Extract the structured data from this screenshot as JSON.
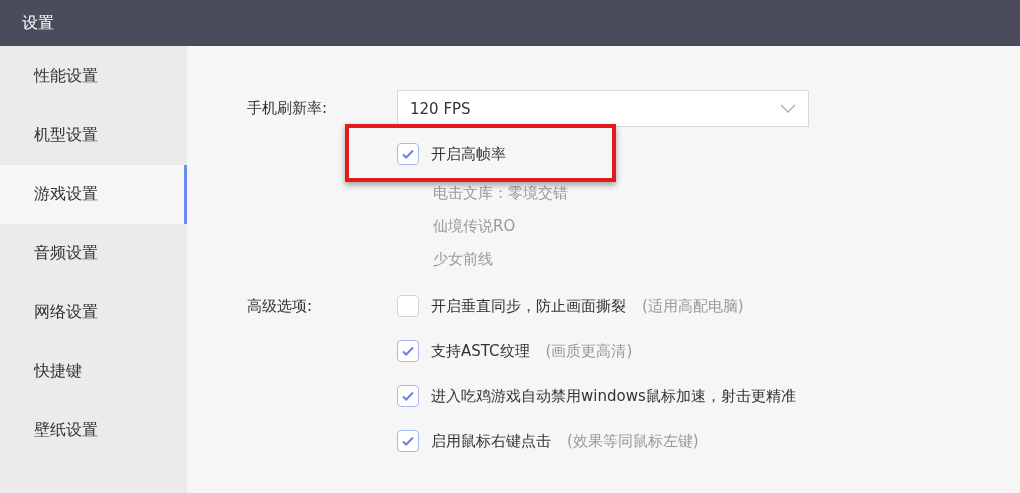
{
  "window": {
    "title": "设置"
  },
  "sidebar": {
    "items": [
      {
        "label": "性能设置",
        "selected": false
      },
      {
        "label": "机型设置",
        "selected": false
      },
      {
        "label": "游戏设置",
        "selected": true
      },
      {
        "label": "音频设置",
        "selected": false
      },
      {
        "label": "网络设置",
        "selected": false
      },
      {
        "label": "快捷键",
        "selected": false
      },
      {
        "label": "壁纸设置",
        "selected": false
      }
    ]
  },
  "refresh_rate": {
    "label": "手机刷新率:",
    "value": "120 FPS"
  },
  "high_frame": {
    "label": "开启高帧率",
    "checked": true,
    "highlighted": true,
    "games": [
      "电击文库：零境交错",
      "仙境传说RO",
      "少女前线"
    ]
  },
  "advanced": {
    "label": "高级选项:",
    "options": [
      {
        "label": "开启垂直同步，防止画面撕裂",
        "note": "(适用高配电脑)",
        "checked": false
      },
      {
        "label": "支持ASTC纹理",
        "note": "(画质更高清)",
        "checked": true
      },
      {
        "label": "进入吃鸡游戏自动禁用windows鼠标加速，射击更精准",
        "checked": true
      },
      {
        "label": "启用鼠标右键点击",
        "note": "(效果等同鼠标左键)",
        "checked": true
      }
    ]
  }
}
